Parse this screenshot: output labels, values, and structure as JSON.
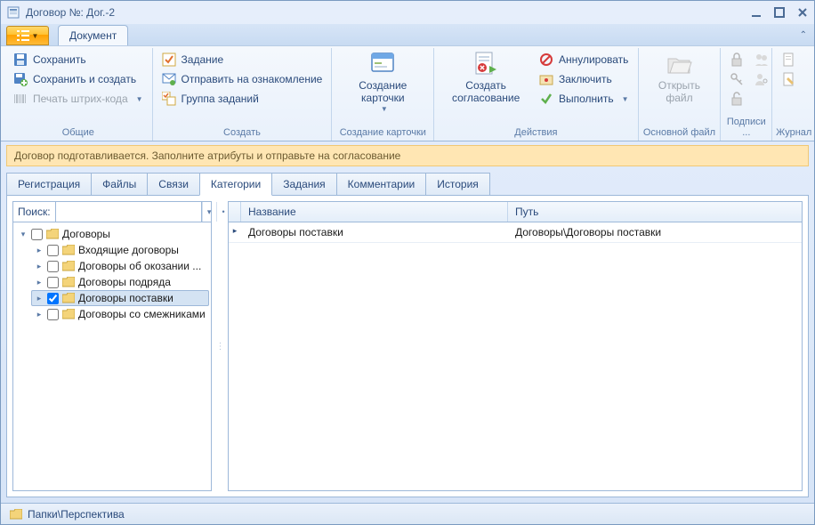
{
  "window": {
    "title": "Договор №: Дог.-2"
  },
  "ribbon": {
    "tab_document": "Документ",
    "groups": {
      "general": {
        "label": "Общие",
        "save": "Сохранить",
        "save_create": "Сохранить и создать",
        "print_barcode": "Печать штрих-кода"
      },
      "create": {
        "label": "Создать",
        "task": "Задание",
        "send_review": "Отправить на ознакомление",
        "task_group": "Группа заданий"
      },
      "create_card": {
        "label": "Создание карточки",
        "create_card": "Создание карточки"
      },
      "actions": {
        "label": "Действия",
        "create_approval": "Создать согласование",
        "annul": "Аннулировать",
        "conclude": "Заключить",
        "execute": "Выполнить"
      },
      "main_file": {
        "label": "Основной файл",
        "open_file": "Открыть файл"
      },
      "signatures": {
        "label": "Подписи ..."
      },
      "journal": {
        "label": "Журнал"
      }
    }
  },
  "status_message": "Договор подготавливается. Заполните атрибуты и отправьте на согласование",
  "content_tabs": {
    "registration": "Регистрация",
    "files": "Файлы",
    "links": "Связи",
    "categories": "Категории",
    "tasks": "Задания",
    "comments": "Комментарии",
    "history": "История"
  },
  "search": {
    "label": "Поиск:",
    "value": ""
  },
  "tree": {
    "root": "Договоры",
    "items": [
      "Входящие договоры",
      "Договоры об окозании ...",
      "Договоры подряда",
      "Договоры поставки",
      "Договоры со смежниками"
    ]
  },
  "grid": {
    "col_name": "Название",
    "col_path": "Путь",
    "rows": [
      {
        "name": "Договоры поставки",
        "path": "Договоры\\Договоры поставки"
      }
    ]
  },
  "footer": {
    "path": "Папки\\Перспектива"
  }
}
